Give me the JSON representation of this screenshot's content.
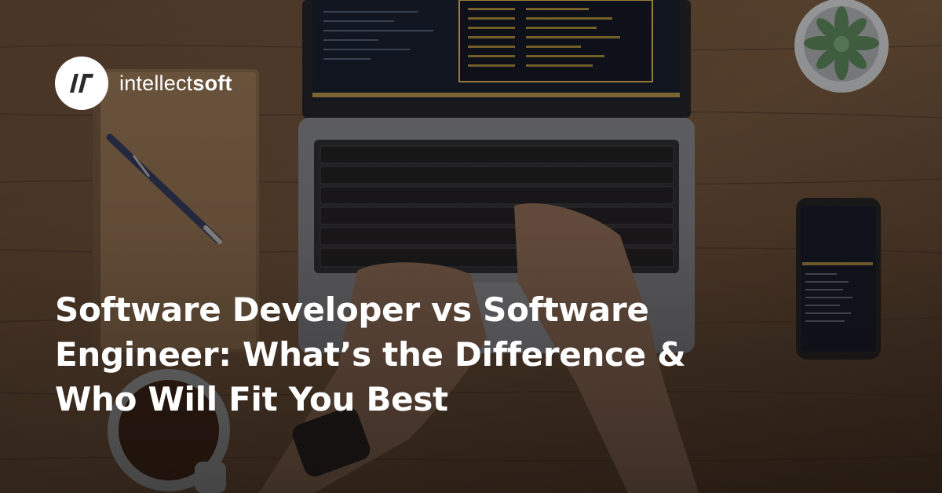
{
  "brand": {
    "name_light": "intellect",
    "name_bold": "soft",
    "logo_icon": "intellectsoft-logo-icon",
    "logo_background": "#ffffff",
    "logo_glyph_color": "#2a2a2a"
  },
  "headline": {
    "lines": [
      "Software Developer vs Software",
      "Engineer: What’s the Difference &",
      "Who Will Fit You Best"
    ],
    "color": "#ffffff"
  },
  "background": {
    "icons": [
      "laptop-icon",
      "notebook-icon",
      "pen-icon",
      "smartphone-icon",
      "coffee-cup-icon",
      "plant-pot-icon",
      "wristwatch-icon"
    ]
  }
}
